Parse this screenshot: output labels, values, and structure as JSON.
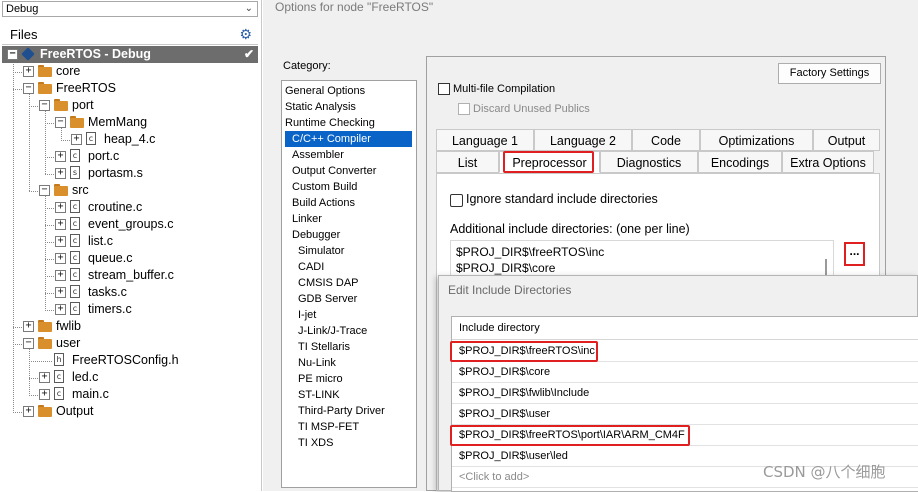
{
  "workspace": {
    "config": "Debug",
    "files_header": "Files",
    "tree": [
      {
        "label": "FreeRTOS - Debug",
        "kind": "project",
        "depth": 0,
        "expander": "minus",
        "selected": true
      },
      {
        "label": "core",
        "kind": "folder",
        "depth": 1,
        "expander": "plus"
      },
      {
        "label": "FreeRTOS",
        "kind": "folder",
        "depth": 1,
        "expander": "minus"
      },
      {
        "label": "port",
        "kind": "folder",
        "depth": 2,
        "expander": "minus"
      },
      {
        "label": "MemMang",
        "kind": "folder",
        "depth": 3,
        "expander": "minus"
      },
      {
        "label": "heap_4.c",
        "kind": "file",
        "depth": 4,
        "expander": "plus"
      },
      {
        "label": "port.c",
        "kind": "file",
        "depth": 3,
        "expander": "plus"
      },
      {
        "label": "portasm.s",
        "kind": "file",
        "depth": 3,
        "expander": "plus"
      },
      {
        "label": "src",
        "kind": "folder",
        "depth": 2,
        "expander": "minus"
      },
      {
        "label": "croutine.c",
        "kind": "file",
        "depth": 3,
        "expander": "plus"
      },
      {
        "label": "event_groups.c",
        "kind": "file",
        "depth": 3,
        "expander": "plus"
      },
      {
        "label": "list.c",
        "kind": "file",
        "depth": 3,
        "expander": "plus"
      },
      {
        "label": "queue.c",
        "kind": "file",
        "depth": 3,
        "expander": "plus"
      },
      {
        "label": "stream_buffer.c",
        "kind": "file",
        "depth": 3,
        "expander": "plus"
      },
      {
        "label": "tasks.c",
        "kind": "file",
        "depth": 3,
        "expander": "plus"
      },
      {
        "label": "timers.c",
        "kind": "file",
        "depth": 3,
        "expander": "plus"
      },
      {
        "label": "fwlib",
        "kind": "folder",
        "depth": 1,
        "expander": "plus"
      },
      {
        "label": "user",
        "kind": "folder",
        "depth": 1,
        "expander": "minus"
      },
      {
        "label": "FreeRTOSConfig.h",
        "kind": "file",
        "depth": 2,
        "expander": "none"
      },
      {
        "label": "led.c",
        "kind": "file",
        "depth": 2,
        "expander": "plus"
      },
      {
        "label": "main.c",
        "kind": "file",
        "depth": 2,
        "expander": "plus"
      },
      {
        "label": "Output",
        "kind": "folder",
        "depth": 1,
        "expander": "plus"
      }
    ]
  },
  "dialog": {
    "title": "Options for node \"FreeRTOS\"",
    "category_label": "Category:",
    "categories": [
      {
        "label": "General Options",
        "level": 0
      },
      {
        "label": "Static Analysis",
        "level": 0
      },
      {
        "label": "Runtime Checking",
        "level": 0
      },
      {
        "label": "C/C++ Compiler",
        "level": 1,
        "selected": true
      },
      {
        "label": "Assembler",
        "level": 1
      },
      {
        "label": "Output Converter",
        "level": 1
      },
      {
        "label": "Custom Build",
        "level": 1
      },
      {
        "label": "Build Actions",
        "level": 1
      },
      {
        "label": "Linker",
        "level": 1
      },
      {
        "label": "Debugger",
        "level": 1
      },
      {
        "label": "Simulator",
        "level": 2
      },
      {
        "label": "CADI",
        "level": 2
      },
      {
        "label": "CMSIS DAP",
        "level": 2
      },
      {
        "label": "GDB Server",
        "level": 2
      },
      {
        "label": "I-jet",
        "level": 2
      },
      {
        "label": "J-Link/J-Trace",
        "level": 2
      },
      {
        "label": "TI Stellaris",
        "level": 2
      },
      {
        "label": "Nu-Link",
        "level": 2
      },
      {
        "label": "PE micro",
        "level": 2
      },
      {
        "label": "ST-LINK",
        "level": 2
      },
      {
        "label": "Third-Party Driver",
        "level": 2
      },
      {
        "label": "TI MSP-FET",
        "level": 2
      },
      {
        "label": "TI XDS",
        "level": 2
      }
    ],
    "factory_settings": "Factory Settings",
    "multi_file": "Multi-file Compilation",
    "discard_unused": "Discard Unused Publics",
    "tabs_row1": [
      "Language 1",
      "Language 2",
      "Code",
      "Optimizations",
      "Output"
    ],
    "tabs_row2": [
      "List",
      "Preprocessor",
      "Diagnostics",
      "Encodings",
      "Extra Options"
    ],
    "active_tab": "Preprocessor",
    "ignore_std": "Ignore standard include directories",
    "additional_label": "Additional include directories: (one per line)",
    "include_lines": [
      "$PROJ_DIR$\\freeRTOS\\inc",
      "$PROJ_DIR$\\core"
    ],
    "browse_label": "..."
  },
  "edit_dialog": {
    "title": "Edit Include Directories",
    "column_header": "Include directory",
    "rows": [
      "$PROJ_DIR$\\freeRTOS\\inc",
      "$PROJ_DIR$\\core",
      "$PROJ_DIR$\\fwlib\\Include",
      "$PROJ_DIR$\\user",
      "$PROJ_DIR$\\freeRTOS\\port\\IAR\\ARM_CM4F",
      "$PROJ_DIR$\\user\\led"
    ],
    "placeholder": "<Click to add>"
  },
  "watermark": "CSDN @八个细胞",
  "colors": {
    "highlight": "#e02020",
    "selection": "#0a64c8",
    "tree_selection": "#6d6d6d",
    "folder": "#d98f2b"
  }
}
